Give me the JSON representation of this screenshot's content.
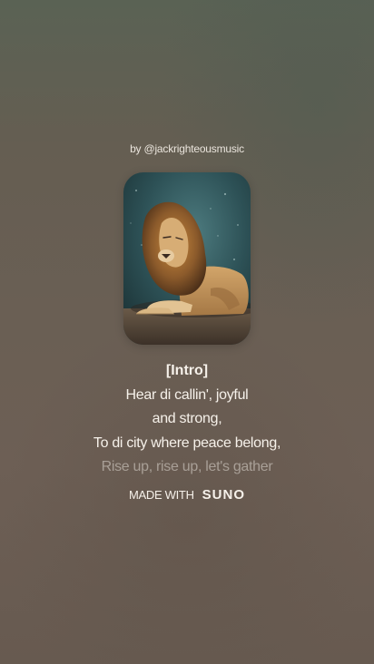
{
  "byline": "by @jackrighteousmusic",
  "cover": {
    "icon": "lion-artwork",
    "alt": "lion album cover"
  },
  "lyrics": [
    "[Intro]",
    "Hear di callin', joyful",
    "and strong,",
    "To di city where peace belong,",
    "Rise up, rise up, let's gather"
  ],
  "footer": {
    "made_with": "MADE WITH",
    "brand": "SUNO"
  },
  "colors": {
    "background_top": "#5a6254",
    "background_bottom": "#675a50",
    "text": "#f6f1ea"
  }
}
